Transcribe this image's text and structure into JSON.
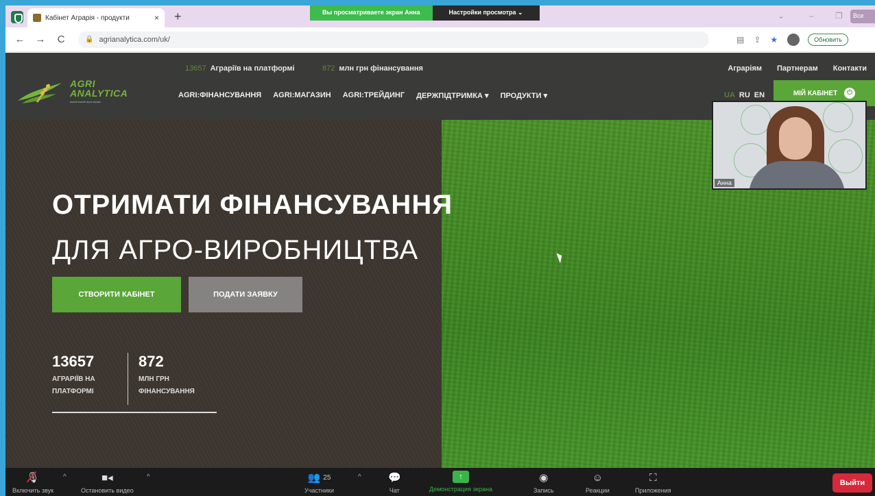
{
  "browser": {
    "tab_title": "Кабінет Аграрія - продукти",
    "close_glyph": "×",
    "new_tab_glyph": "+",
    "share_banner": {
      "viewing_text": "Вы просматриваете экран Анна",
      "settings_text": "Настройки просмотра ⌄"
    },
    "window_controls": [
      "⌄",
      "–",
      "❐"
    ],
    "vertical_btn_text": "Все",
    "nav": {
      "back": "←",
      "forward": "→",
      "reload": "C"
    },
    "url": "agrianalytica.com/uk/",
    "update_btn": "Обновить"
  },
  "site": {
    "top_stats": [
      {
        "num": "13657",
        "label": "Аграріїв на платформі"
      },
      {
        "num": "872",
        "label": "млн грн фінансування"
      }
    ],
    "top_links": [
      "Аграріям",
      "Партнерам",
      "Контакти"
    ],
    "logo": {
      "line1": "AGRI",
      "line2": "ANALYTICA",
      "tagline": "аналітичний агро-сервіс"
    },
    "nav_items": [
      "AGRI:ФІНАНСУВАННЯ",
      "AGRI:МАГАЗИН",
      "AGRI:ТРЕЙДИНГ",
      "ДЕРЖПІДТРИМКА ▾",
      "ПРОДУКТИ ▾"
    ],
    "langs": [
      "UA",
      "RU",
      "EN"
    ],
    "cabinet_btn": "МІЙ КАБІНЕТ",
    "cabinet_icon": "⏻",
    "hero": {
      "title": "ОТРИМАТИ ФІНАНСУВАННЯ",
      "subtitle": "ДЛЯ АГРО-ВИРОБНИЦТВА",
      "btn_create": "СТВОРИТИ КАБІНЕТ",
      "btn_apply": "ПОДАТИ ЗАЯВКУ",
      "stats": [
        {
          "value": "13657",
          "label1": "АГРАРІЇВ НА",
          "label2": "ПЛАТФОРМІ"
        },
        {
          "value": "872",
          "label1": "МЛН ГРН",
          "label2": "ФІНАНСУВАННЯ"
        }
      ]
    }
  },
  "participant": {
    "name": "Анна"
  },
  "zoom": {
    "mute_label": "Включить звук",
    "video_label": "Остановить видео",
    "participants_label": "Участники",
    "participants_count": "25",
    "chat_label": "Чат",
    "share_label": "Демонстрация экрана",
    "record_label": "Запись",
    "reactions_label": "Реакции",
    "apps_label": "Приложения",
    "exit_label": "Выйти",
    "caret_glyph": "^",
    "share_glyph": "↑"
  }
}
